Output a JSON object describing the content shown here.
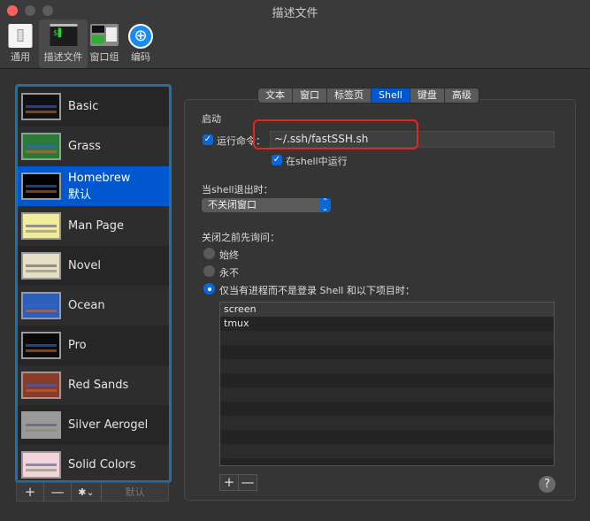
{
  "window": {
    "title": "描述文件"
  },
  "toolbar": [
    {
      "label": "通用",
      "icon": "switch-icon"
    },
    {
      "label": "描述文件",
      "icon": "terminal-icon"
    },
    {
      "label": "窗口组",
      "icon": "window-group-icon"
    },
    {
      "label": "编码",
      "icon": "globe-icon"
    }
  ],
  "profiles": [
    {
      "name": "Basic",
      "color": "#111111"
    },
    {
      "name": "Grass",
      "color": "#2a7a3a"
    },
    {
      "name": "Homebrew",
      "color": "#000000",
      "sub": "默认"
    },
    {
      "name": "Man Page",
      "color": "#f3ec9e"
    },
    {
      "name": "Novel",
      "color": "#e6dfc6"
    },
    {
      "name": "Ocean",
      "color": "#2d5fb8"
    },
    {
      "name": "Pro",
      "color": "#0a0a0a"
    },
    {
      "name": "Red Sands",
      "color": "#8a3c2c"
    },
    {
      "name": "Silver Aerogel",
      "color": "#9a9a9a"
    },
    {
      "name": "Solid Colors",
      "color": "#f1d4dc"
    }
  ],
  "list_bar": {
    "add": "+",
    "remove": "—",
    "gear": "✱⌄",
    "default": "默认"
  },
  "tabs": [
    "文本",
    "窗口",
    "标签页",
    "Shell",
    "键盘",
    "高级"
  ],
  "startup": {
    "heading": "启动",
    "run_command_label": "运行命令：",
    "command": "~/.ssh/fastSSH.sh",
    "run_in_shell_label": "在shell中运行"
  },
  "on_exit": {
    "heading": "当shell退出时：",
    "selected": "不关闭窗口"
  },
  "ask_before": {
    "heading": "关闭之前先询问：",
    "options": [
      "始终",
      "永不",
      "仅当有进程而不是登录 Shell 和以下项目时："
    ],
    "selected_index": 2
  },
  "processes": [
    "screen",
    "tmux"
  ],
  "table_bar": {
    "add": "+",
    "remove": "—"
  },
  "help": "?",
  "accent": "#0058d0"
}
